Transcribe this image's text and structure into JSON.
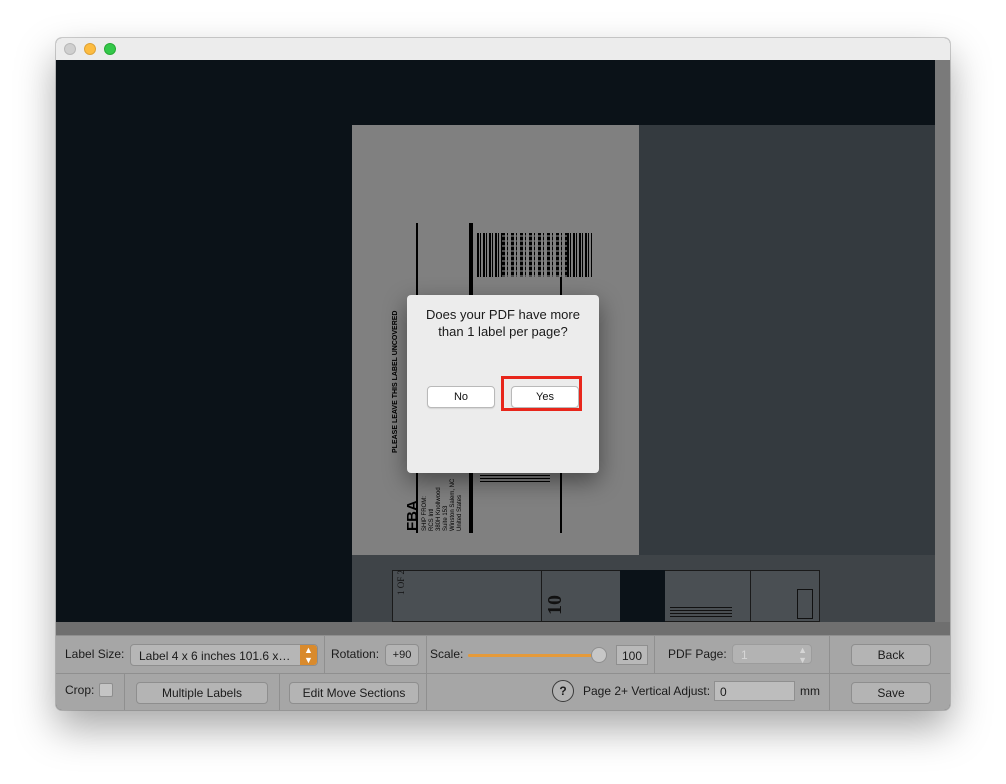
{
  "dialog": {
    "message": "Does your PDF have more than 1 label per page?",
    "no_label": "No",
    "yes_label": "Yes"
  },
  "label_preview": {
    "vertical_notice": "PLEASE LEAVE THIS LABEL UNCOVERED",
    "fba": "FBA",
    "ship_from_lines": [
      "SHIP FROM:",
      "RCS Intl",
      "380H Knollwood",
      "Suite 153",
      "Winston Salem, NC",
      "United States"
    ],
    "page_of": "1 OF 2",
    "page_num_fragment": "10"
  },
  "toolbar": {
    "label_size_label": "Label Size:",
    "label_size_value": "Label 4 x 6 inches 101.6 x…",
    "rotation_label": "Rotation:",
    "rotation_value": "+90",
    "scale_label": "Scale:",
    "scale_value": "100",
    "scale_fraction": 1.0,
    "pdf_page_label": "PDF Page:",
    "pdf_page_value": "1",
    "back_label": "Back",
    "crop_label": "Crop:",
    "multiple_labels_label": "Multiple Labels",
    "edit_move_sections_label": "Edit Move Sections",
    "help_symbol": "?",
    "vertical_adjust_label": "Page 2+ Vertical Adjust:",
    "vertical_adjust_value": "0",
    "vertical_adjust_unit": "mm",
    "save_label": "Save"
  },
  "colors": {
    "accent": "#e59a3a",
    "highlight": "#e8261b",
    "canvas": "#0b1218"
  }
}
